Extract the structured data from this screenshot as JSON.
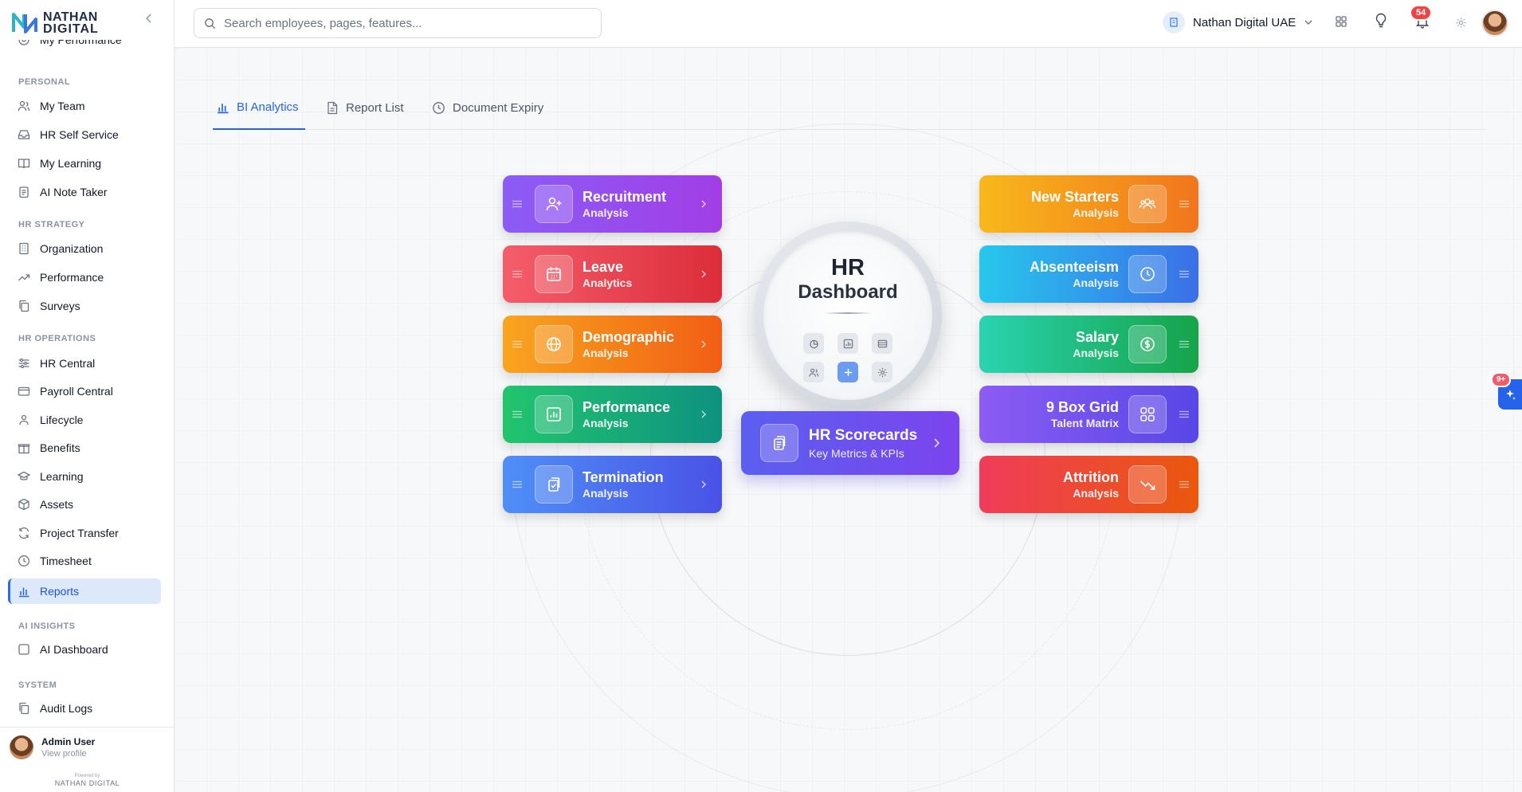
{
  "brand": {
    "line1": "NATHAN",
    "line2": "DIGITAL"
  },
  "sidebar": {
    "partial_item": "My Performance",
    "sections": [
      {
        "title": "PERSONAL",
        "items": [
          {
            "label": "My Team",
            "icon": "users-icon"
          },
          {
            "label": "HR Self Service",
            "icon": "inbox-icon"
          },
          {
            "label": "My Learning",
            "icon": "book-icon"
          },
          {
            "label": "AI Note Taker",
            "icon": "clipboard-icon"
          }
        ]
      },
      {
        "title": "HR STRATEGY",
        "items": [
          {
            "label": "Organization",
            "icon": "building-icon"
          },
          {
            "label": "Performance",
            "icon": "trending-up-icon"
          },
          {
            "label": "Surveys",
            "icon": "copy-icon"
          }
        ]
      },
      {
        "title": "HR OPERATIONS",
        "items": [
          {
            "label": "HR Central",
            "icon": "sliders-icon"
          },
          {
            "label": "Payroll Central",
            "icon": "credit-card-icon"
          },
          {
            "label": "Lifecycle",
            "icon": "user-cycle-icon"
          },
          {
            "label": "Benefits",
            "icon": "gift-icon"
          },
          {
            "label": "Learning",
            "icon": "graduation-cap-icon"
          },
          {
            "label": "Assets",
            "icon": "box-icon"
          },
          {
            "label": "Project Transfer",
            "icon": "refresh-icon"
          },
          {
            "label": "Timesheet",
            "icon": "clock-icon"
          },
          {
            "label": "Reports",
            "icon": "bar-chart-icon",
            "active": true
          }
        ]
      },
      {
        "title": "AI INSIGHTS",
        "items": [
          {
            "label": "AI Dashboard",
            "icon": "square-icon"
          }
        ]
      },
      {
        "title": "SYSTEM",
        "items": [
          {
            "label": "Audit Logs",
            "icon": "files-icon"
          }
        ]
      }
    ],
    "user": {
      "name": "Admin User",
      "sub": "View profile"
    },
    "powered_by": "Powered by",
    "powered_brand": "NATHAN DIGITAL"
  },
  "topbar": {
    "search_placeholder": "Search employees, pages, features...",
    "org_name": "Nathan Digital UAE",
    "notif_count": "54"
  },
  "tabs": [
    {
      "label": "BI Analytics",
      "active": true
    },
    {
      "label": "Report List"
    },
    {
      "label": "Document Expiry"
    }
  ],
  "hub": {
    "line1": "HR",
    "line2": "Dashboard"
  },
  "left_cards": [
    {
      "title": "Recruitment",
      "sub": "Analysis"
    },
    {
      "title": "Leave",
      "sub": "Analytics"
    },
    {
      "title": "Demographic",
      "sub": "Analysis"
    },
    {
      "title": "Performance",
      "sub": "Analysis"
    },
    {
      "title": "Termination",
      "sub": "Analysis"
    }
  ],
  "right_cards": [
    {
      "title": "New Starters",
      "sub": "Analysis"
    },
    {
      "title": "Absenteeism",
      "sub": "Analysis"
    },
    {
      "title": "Salary",
      "sub": "Analysis"
    },
    {
      "title": "9 Box Grid",
      "sub": "Talent Matrix"
    },
    {
      "title": "Attrition",
      "sub": "Analysis"
    }
  ],
  "scorecards": {
    "title": "HR Scorecards",
    "sub": "Key Metrics & KPIs"
  },
  "ai_badge": "9+",
  "colors": {
    "accent": "#2563eb",
    "active_bg": "#dde9fb"
  }
}
